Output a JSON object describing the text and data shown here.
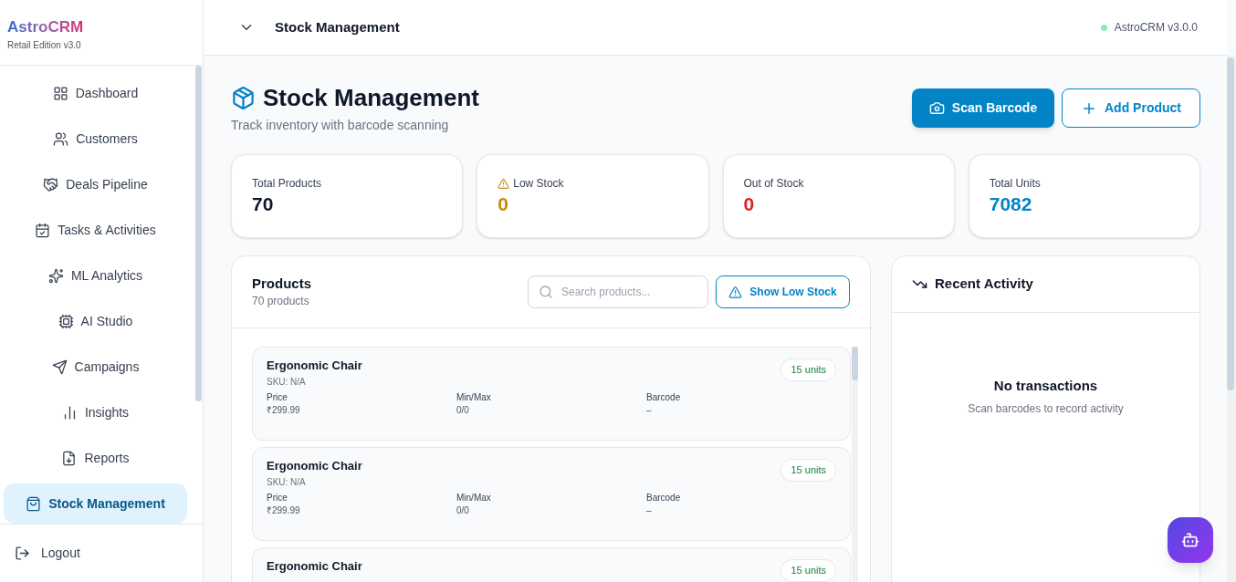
{
  "brand": {
    "name": "AstroCRM",
    "edition": "Retail Edition v3.0"
  },
  "sidebar": {
    "items": [
      {
        "label": "Dashboard",
        "selected": false
      },
      {
        "label": "Customers",
        "selected": false
      },
      {
        "label": "Deals Pipeline",
        "selected": false
      },
      {
        "label": "Tasks & Activities",
        "selected": false
      },
      {
        "label": "ML Analytics",
        "selected": false
      },
      {
        "label": "AI Studio",
        "selected": false
      },
      {
        "label": "Campaigns",
        "selected": false
      },
      {
        "label": "Insights",
        "selected": false
      },
      {
        "label": "Reports",
        "selected": false
      },
      {
        "label": "Stock Management",
        "selected": true
      }
    ],
    "logout": "Logout"
  },
  "header": {
    "title": "Stock Management",
    "version": "AstroCRM v3.0.0"
  },
  "page": {
    "title": "Stock Management",
    "subtitle": "Track inventory with barcode scanning",
    "buttons": [
      {
        "label": "Scan Barcode",
        "kind": "primary"
      },
      {
        "label": "Add Product",
        "kind": "outline"
      }
    ]
  },
  "stats": [
    {
      "label": "Total Products",
      "value": "70",
      "kind": "neutral"
    },
    {
      "label": "Low Stock",
      "value": "0",
      "kind": "warning"
    },
    {
      "label": "Out of Stock",
      "value": "0",
      "kind": "danger"
    },
    {
      "label": "Total Units",
      "value": "7082",
      "kind": "info"
    }
  ],
  "products": {
    "title": "Products",
    "count": "70 products",
    "search": {
      "placeholder": "Search products..."
    },
    "filter_button": "Show Low Stock",
    "items": [
      {
        "name": "Ergonomic Chair",
        "units": "15 units",
        "sku": "SKU: N/A",
        "fields": [
          {
            "label": "Price",
            "value": "₹299.99"
          },
          {
            "label": "Min/Max",
            "value": "0/0"
          },
          {
            "label": "Barcode",
            "value": "–"
          }
        ]
      },
      {
        "name": "Ergonomic Chair",
        "units": "15 units",
        "sku": "SKU: N/A",
        "fields": [
          {
            "label": "Price",
            "value": "₹299.99"
          },
          {
            "label": "Min/Max",
            "value": "0/0"
          },
          {
            "label": "Barcode",
            "value": "–"
          }
        ]
      },
      {
        "name": "Ergonomic Chair",
        "units": "15 units"
      }
    ]
  },
  "activity": {
    "title": "Recent Activity",
    "empty_title": "No transactions",
    "empty_text": "Scan barcodes to record activity"
  }
}
